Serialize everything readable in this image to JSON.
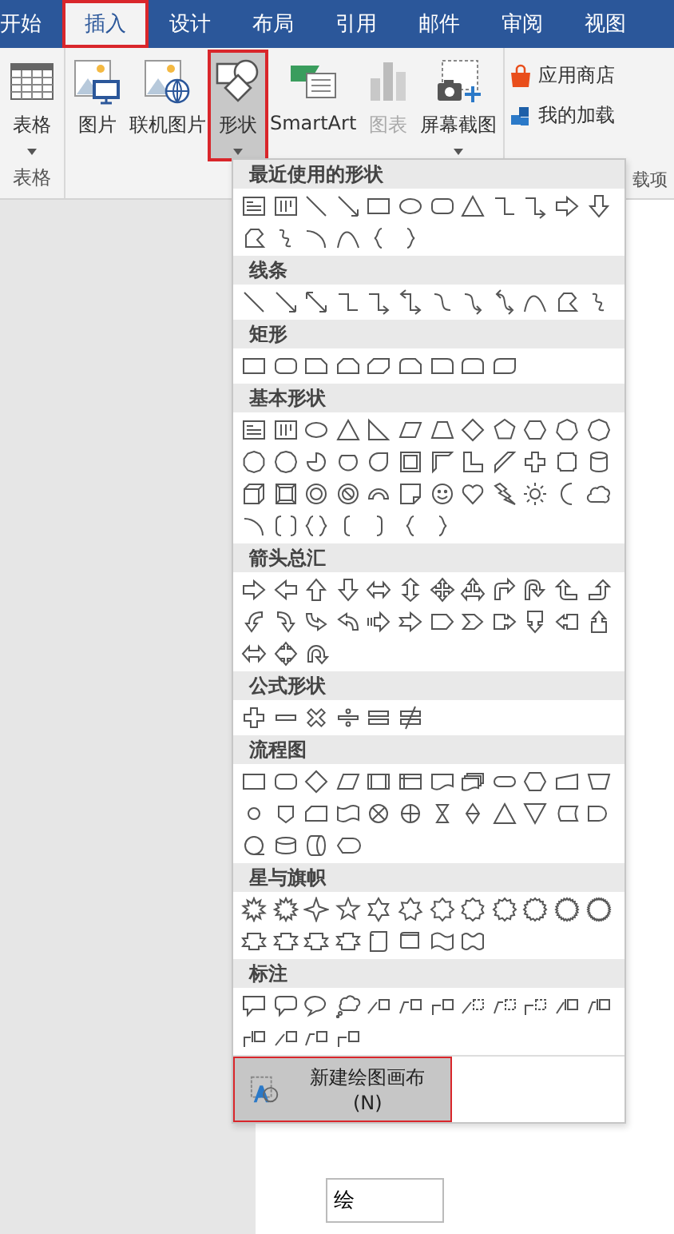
{
  "tabs": [
    {
      "label": "开始",
      "selected": false,
      "outlined": false
    },
    {
      "label": "插入",
      "selected": true,
      "outlined": true
    },
    {
      "label": "设计",
      "selected": false,
      "outlined": false
    },
    {
      "label": "布局",
      "selected": false,
      "outlined": false
    },
    {
      "label": "引用",
      "selected": false,
      "outlined": false
    },
    {
      "label": "邮件",
      "selected": false,
      "outlined": false
    },
    {
      "label": "审阅",
      "selected": false,
      "outlined": false
    },
    {
      "label": "视图",
      "selected": false,
      "outlined": false
    }
  ],
  "ribbon": {
    "groups": [
      {
        "label": "表格",
        "buttons": [
          {
            "kind": "table",
            "label": "表格",
            "dropdown": true,
            "pressed": false,
            "disabled": false,
            "outlined": false
          }
        ]
      },
      {
        "buttons": [
          {
            "kind": "picture",
            "label": "图片",
            "dropdown": false,
            "pressed": false,
            "disabled": false,
            "outlined": false
          },
          {
            "kind": "online-picture",
            "label": "联机图片",
            "dropdown": false,
            "pressed": false,
            "disabled": false,
            "outlined": false
          },
          {
            "kind": "shapes",
            "label": "形状",
            "dropdown": true,
            "pressed": true,
            "disabled": false,
            "outlined": true
          },
          {
            "kind": "smartart",
            "label": "SmartArt",
            "dropdown": false,
            "pressed": false,
            "disabled": false,
            "outlined": false
          },
          {
            "kind": "chart",
            "label": "图表",
            "dropdown": false,
            "pressed": false,
            "disabled": true,
            "outlined": false
          },
          {
            "kind": "screenshot",
            "label": "屏幕截图",
            "dropdown": true,
            "pressed": false,
            "disabled": false,
            "outlined": false
          }
        ]
      },
      {
        "label": "载项",
        "buttons": [
          {
            "kind": "store",
            "label": "应用商店",
            "dropdown": false,
            "pressed": false,
            "disabled": false,
            "outlined": false
          },
          {
            "kind": "addins",
            "label": "我的加载",
            "dropdown": false,
            "pressed": false,
            "disabled": false,
            "outlined": false
          }
        ]
      }
    ]
  },
  "shapes_menu": {
    "sections": [
      {
        "title": "最近使用的形状"
      },
      {
        "title": "线条"
      },
      {
        "title": "矩形"
      },
      {
        "title": "基本形状"
      },
      {
        "title": "箭头总汇"
      },
      {
        "title": "公式形状"
      },
      {
        "title": "流程图"
      },
      {
        "title": "星与旗帜"
      },
      {
        "title": "标注"
      }
    ],
    "footer": {
      "label": "新建绘图画布(N)",
      "highlighted": true,
      "outlined": true
    }
  },
  "document": {
    "text_box": "绘"
  }
}
